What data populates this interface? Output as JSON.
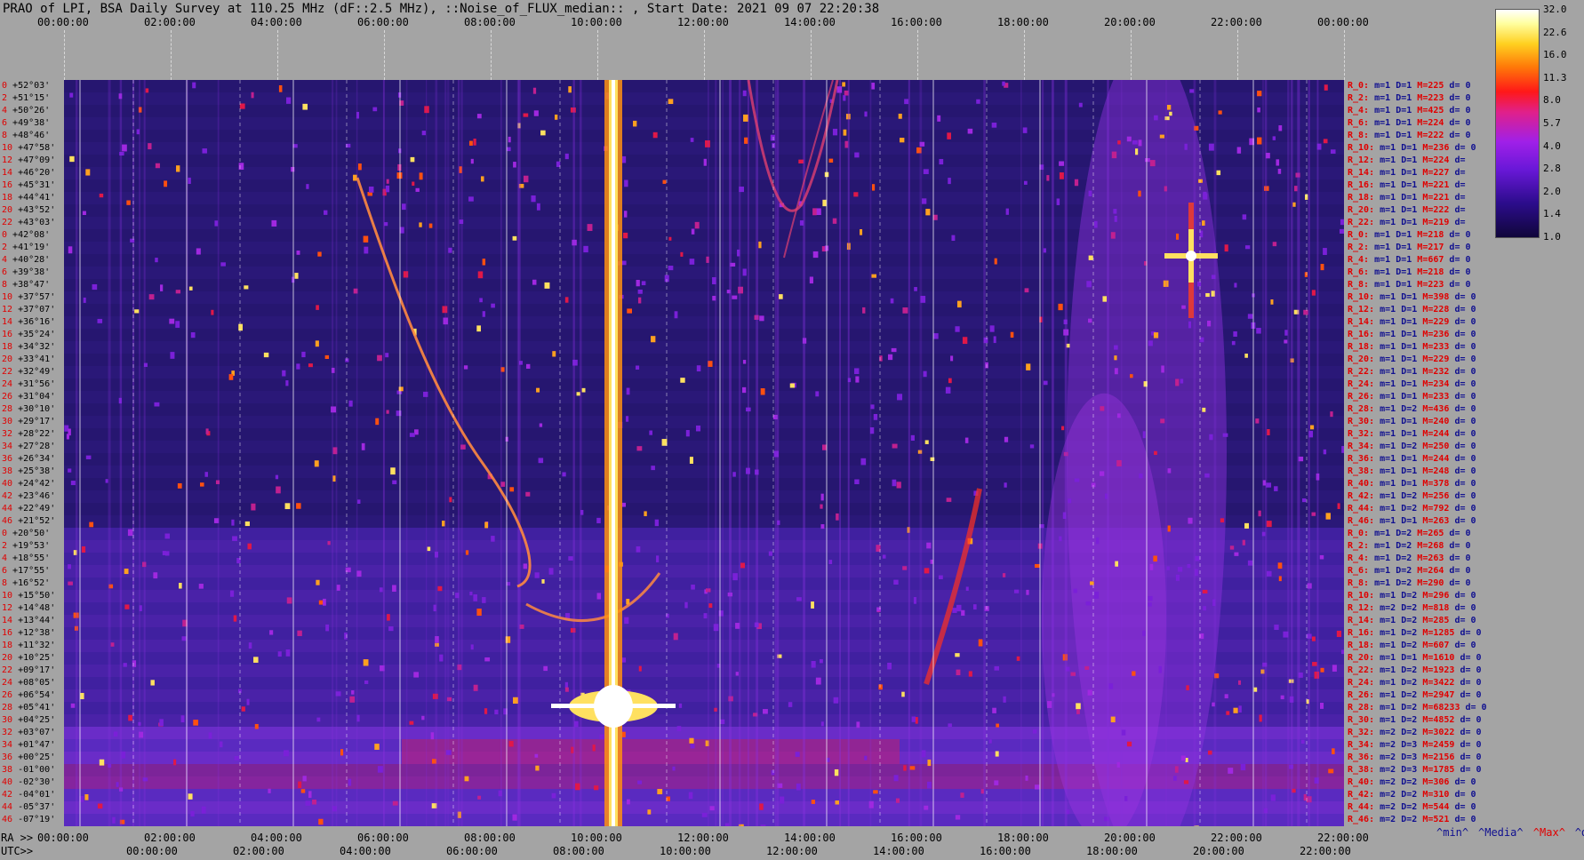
{
  "title": "PRAO of LPI, BSA Daily Survey at 110.25 MHz (dF::2.5 MHz), ::Noise_of_FLUX_median:: , Start Date: 2021 09 07 22:20:38",
  "colors": {
    "background": "#a4a4a4",
    "plot_bg": "#241866",
    "label_red": "#e00000",
    "label_blue": "#101090"
  },
  "chart_data": {
    "type": "heatmap",
    "title": "PRAO of LPI, BSA Daily Survey at 110.25 MHz (dF::2.5 MHz), ::Noise_of_FLUX_median:: , Start Date: 2021 09 07 22:20:38",
    "x_top_ticks": [
      "00:00:00",
      "02:00:00",
      "04:00:00",
      "06:00:00",
      "08:00:00",
      "10:00:00",
      "12:00:00",
      "14:00:00",
      "16:00:00",
      "18:00:00",
      "20:00:00",
      "22:00:00",
      "00:00:00"
    ],
    "x_ra_ticks": [
      "00:00:00",
      "02:00:00",
      "04:00:00",
      "06:00:00",
      "08:00:00",
      "10:00:00",
      "12:00:00",
      "14:00:00",
      "16:00:00",
      "18:00:00",
      "20:00:00",
      "22:00:00",
      "22:00:00"
    ],
    "x_utc_ticks": [
      "00:00:00",
      "02:00:00",
      "04:00:00",
      "06:00:00",
      "08:00:00",
      "10:00:00",
      "12:00:00",
      "14:00:00",
      "16:00:00",
      "18:00:00",
      "20:00:00",
      "22:00:00"
    ],
    "ra_label": "RA >>",
    "utc_label": "UTC>>",
    "declinations": [
      "+52°03'",
      "+51°15'",
      "+50°26'",
      "+49°38'",
      "+48°46'",
      "+47°58'",
      "+47°09'",
      "+46°20'",
      "+45°31'",
      "+44°41'",
      "+43°52'",
      "+43°03'",
      "+42°08'",
      "+41°19'",
      "+40°28'",
      "+39°38'",
      "+38°47'",
      "+37°57'",
      "+37°07'",
      "+36°16'",
      "+35°24'",
      "+34°32'",
      "+33°41'",
      "+32°49'",
      "+31°56'",
      "+31°04'",
      "+30°10'",
      "+29°17'",
      "+28°22'",
      "+27°28'",
      "+26°34'",
      "+25°38'",
      "+24°42'",
      "+23°46'",
      "+22°49'",
      "+21°52'",
      "+20°50'",
      "+19°53'",
      "+18°55'",
      "+17°55'",
      "+16°52'",
      "+15°50'",
      "+14°48'",
      "+13°44'",
      "+12°38'",
      "+11°32'",
      "+10°25'",
      "+09°17'",
      "+08°05'",
      "+06°54'",
      "+05°41'",
      "+04°25'",
      "+03°07'",
      "+01°47'",
      "+00°25'",
      "-01°00'",
      "-02°30'",
      "-04°01'",
      "-05°37'",
      "-07°19'"
    ],
    "row_index": [
      "0",
      "2",
      "4",
      "6",
      "8",
      "10",
      "12",
      "14",
      "16",
      "18",
      "20",
      "22",
      "0",
      "2",
      "4",
      "6",
      "8",
      "10",
      "12",
      "14",
      "16",
      "18",
      "20",
      "22",
      "24",
      "26",
      "28",
      "30",
      "32",
      "34",
      "36",
      "38",
      "40",
      "42",
      "44",
      "46",
      "0",
      "2",
      "4",
      "6",
      "8",
      "10",
      "12",
      "14",
      "16",
      "18",
      "20",
      "22",
      "24",
      "26",
      "28",
      "30",
      "32",
      "34",
      "36",
      "38",
      "40",
      "42",
      "44",
      "46"
    ],
    "channels": [
      {
        "r": "R_0:",
        "m": "m=1",
        "D": "D=1",
        "M": "M=225",
        "d": "d= 0"
      },
      {
        "r": "R_2:",
        "m": "m=1",
        "D": "D=1",
        "M": "M=223",
        "d": "d= 0"
      },
      {
        "r": "R_4:",
        "m": "m=1",
        "D": "D=1",
        "M": "M=425",
        "d": "d= 0"
      },
      {
        "r": "R_6:",
        "m": "m=1",
        "D": "D=1",
        "M": "M=224",
        "d": "d= 0"
      },
      {
        "r": "R_8:",
        "m": "m=1",
        "D": "D=1",
        "M": "M=222",
        "d": "d= 0"
      },
      {
        "r": "R_10:",
        "m": "m=1",
        "D": "D=1",
        "M": "M=236",
        "d": "d= 0"
      },
      {
        "r": "R_12:",
        "m": "m=1",
        "D": "D=1",
        "M": "M=224",
        "d": "d="
      },
      {
        "r": "R_14:",
        "m": "m=1",
        "D": "D=1",
        "M": "M=227",
        "d": "d="
      },
      {
        "r": "R_16:",
        "m": "m=1",
        "D": "D=1",
        "M": "M=221",
        "d": "d="
      },
      {
        "r": "R_18:",
        "m": "m=1",
        "D": "D=1",
        "M": "M=221",
        "d": "d="
      },
      {
        "r": "R_20:",
        "m": "m=1",
        "D": "D=1",
        "M": "M=222",
        "d": "d="
      },
      {
        "r": "R_22:",
        "m": "m=1",
        "D": "D=1",
        "M": "M=219",
        "d": "d="
      },
      {
        "r": "R_0:",
        "m": "m=1",
        "D": "D=1",
        "M": "M=218",
        "d": "d= 0"
      },
      {
        "r": "R_2:",
        "m": "m=1",
        "D": "D=1",
        "M": "M=217",
        "d": "d= 0"
      },
      {
        "r": "R_4:",
        "m": "m=1",
        "D": "D=1",
        "M": "M=667",
        "d": "d= 0"
      },
      {
        "r": "R_6:",
        "m": "m=1",
        "D": "D=1",
        "M": "M=218",
        "d": "d= 0"
      },
      {
        "r": "R_8:",
        "m": "m=1",
        "D": "D=1",
        "M": "M=223",
        "d": "d= 0"
      },
      {
        "r": "R_10:",
        "m": "m=1",
        "D": "D=1",
        "M": "M=398",
        "d": "d= 0"
      },
      {
        "r": "R_12:",
        "m": "m=1",
        "D": "D=1",
        "M": "M=228",
        "d": "d= 0"
      },
      {
        "r": "R_14:",
        "m": "m=1",
        "D": "D=1",
        "M": "M=229",
        "d": "d= 0"
      },
      {
        "r": "R_16:",
        "m": "m=1",
        "D": "D=1",
        "M": "M=236",
        "d": "d= 0"
      },
      {
        "r": "R_18:",
        "m": "m=1",
        "D": "D=1",
        "M": "M=233",
        "d": "d= 0"
      },
      {
        "r": "R_20:",
        "m": "m=1",
        "D": "D=1",
        "M": "M=229",
        "d": "d= 0"
      },
      {
        "r": "R_22:",
        "m": "m=1",
        "D": "D=1",
        "M": "M=232",
        "d": "d= 0"
      },
      {
        "r": "R_24:",
        "m": "m=1",
        "D": "D=1",
        "M": "M=234",
        "d": "d= 0"
      },
      {
        "r": "R_26:",
        "m": "m=1",
        "D": "D=1",
        "M": "M=233",
        "d": "d= 0"
      },
      {
        "r": "R_28:",
        "m": "m=1",
        "D": "D=2",
        "M": "M=436",
        "d": "d= 0"
      },
      {
        "r": "R_30:",
        "m": "m=1",
        "D": "D=1",
        "M": "M=240",
        "d": "d= 0"
      },
      {
        "r": "R_32:",
        "m": "m=1",
        "D": "D=1",
        "M": "M=244",
        "d": "d= 0"
      },
      {
        "r": "R_34:",
        "m": "m=1",
        "D": "D=2",
        "M": "M=250",
        "d": "d= 0"
      },
      {
        "r": "R_36:",
        "m": "m=1",
        "D": "D=1",
        "M": "M=244",
        "d": "d= 0"
      },
      {
        "r": "R_38:",
        "m": "m=1",
        "D": "D=1",
        "M": "M=248",
        "d": "d= 0"
      },
      {
        "r": "R_40:",
        "m": "m=1",
        "D": "D=1",
        "M": "M=378",
        "d": "d= 0"
      },
      {
        "r": "R_42:",
        "m": "m=1",
        "D": "D=2",
        "M": "M=256",
        "d": "d= 0"
      },
      {
        "r": "R_44:",
        "m": "m=1",
        "D": "D=2",
        "M": "M=792",
        "d": "d= 0"
      },
      {
        "r": "R_46:",
        "m": "m=1",
        "D": "D=1",
        "M": "M=263",
        "d": "d= 0"
      },
      {
        "r": "R_0:",
        "m": "m=1",
        "D": "D=2",
        "M": "M=265",
        "d": "d= 0"
      },
      {
        "r": "R_2:",
        "m": "m=1",
        "D": "D=2",
        "M": "M=268",
        "d": "d= 0"
      },
      {
        "r": "R_4:",
        "m": "m=1",
        "D": "D=2",
        "M": "M=263",
        "d": "d= 0"
      },
      {
        "r": "R_6:",
        "m": "m=1",
        "D": "D=2",
        "M": "M=264",
        "d": "d= 0"
      },
      {
        "r": "R_8:",
        "m": "m=1",
        "D": "D=2",
        "M": "M=290",
        "d": "d= 0"
      },
      {
        "r": "R_10:",
        "m": "m=1",
        "D": "D=2",
        "M": "M=296",
        "d": "d= 0"
      },
      {
        "r": "R_12:",
        "m": "m=2",
        "D": "D=2",
        "M": "M=818",
        "d": "d= 0"
      },
      {
        "r": "R_14:",
        "m": "m=1",
        "D": "D=2",
        "M": "M=285",
        "d": "d= 0"
      },
      {
        "r": "R_16:",
        "m": "m=1",
        "D": "D=2",
        "M": "M=1285",
        "d": "d= 0"
      },
      {
        "r": "R_18:",
        "m": "m=1",
        "D": "D=2",
        "M": "M=607",
        "d": "d= 0"
      },
      {
        "r": "R_20:",
        "m": "m=1",
        "D": "D=1",
        "M": "M=1610",
        "d": "d= 0"
      },
      {
        "r": "R_22:",
        "m": "m=1",
        "D": "D=2",
        "M": "M=1923",
        "d": "d= 0"
      },
      {
        "r": "R_24:",
        "m": "m=1",
        "D": "D=2",
        "M": "M=3422",
        "d": "d= 0"
      },
      {
        "r": "R_26:",
        "m": "m=1",
        "D": "D=2",
        "M": "M=2947",
        "d": "d= 0"
      },
      {
        "r": "R_28:",
        "m": "m=1",
        "D": "D=2",
        "M": "M=68233",
        "d": "d= 0"
      },
      {
        "r": "R_30:",
        "m": "m=1",
        "D": "D=2",
        "M": "M=4852",
        "d": "d= 0"
      },
      {
        "r": "R_32:",
        "m": "m=2",
        "D": "D=2",
        "M": "M=3022",
        "d": "d= 0"
      },
      {
        "r": "R_34:",
        "m": "m=2",
        "D": "D=3",
        "M": "M=2459",
        "d": "d= 0"
      },
      {
        "r": "R_36:",
        "m": "m=2",
        "D": "D=3",
        "M": "M=2156",
        "d": "d= 0"
      },
      {
        "r": "R_38:",
        "m": "m=2",
        "D": "D=3",
        "M": "M=1785",
        "d": "d= 0"
      },
      {
        "r": "R_40:",
        "m": "m=2",
        "D": "D=2",
        "M": "M=306",
        "d": "d= 0"
      },
      {
        "r": "R_42:",
        "m": "m=2",
        "D": "D=2",
        "M": "M=310",
        "d": "d= 0"
      },
      {
        "r": "R_44:",
        "m": "m=2",
        "D": "D=2",
        "M": "M=544",
        "d": "d= 0"
      },
      {
        "r": "R_46:",
        "m": "m=2",
        "D": "D=2",
        "M": "M=521",
        "d": "d= 0"
      }
    ],
    "colorbar_ticks": [
      "32.0",
      "22.6",
      "16.0",
      "11.3",
      "8.0",
      "5.7",
      "4.0",
      "2.8",
      "2.0",
      "1.4",
      "1.0"
    ],
    "colorbar_colors": [
      "#10063a",
      "#2c0c8c",
      "#6a18d8",
      "#a020e8",
      "#e0208a",
      "#ff1818",
      "#ff7a08",
      "#ffd020",
      "#ffffa0",
      "#ffffff"
    ],
    "legend": [
      {
        "text": "^min^",
        "color": "#101090"
      },
      {
        "text": "^Media^",
        "color": "#101090"
      },
      {
        "text": "^Max^",
        "color": "#e00000"
      },
      {
        "text": "^devia^",
        "color": "#101090"
      }
    ],
    "bright_source_ut_hours": [
      11.0,
      20.0
    ],
    "grid": true
  }
}
